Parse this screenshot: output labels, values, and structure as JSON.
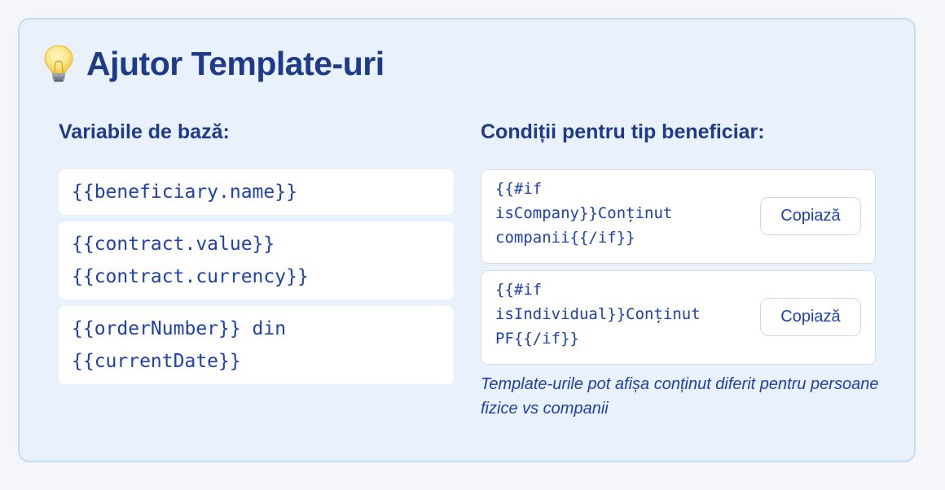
{
  "panel": {
    "title": "Ajutor Template-uri",
    "title_icon": "lightbulb-icon"
  },
  "basic_vars": {
    "heading": "Variabile de bază:",
    "items": [
      {
        "lines": [
          "{{beneficiary.name}}"
        ]
      },
      {
        "lines": [
          "{{contract.value}}",
          "{{contract.currency}}"
        ]
      },
      {
        "lines": [
          "{{orderNumber}} din",
          "{{currentDate}}"
        ]
      }
    ]
  },
  "conditions": {
    "heading": "Condiții pentru tip beneficiar:",
    "items": [
      {
        "lines": [
          "{{#if",
          "isCompany}}Conținut",
          "companii{{/if}}"
        ],
        "button_label": "Copiază"
      },
      {
        "lines": [
          "{{#if",
          "isIndividual}}Conținut",
          "PF{{/if}}"
        ],
        "button_label": "Copiază"
      }
    ],
    "note": "Template-urile pot afișa conținut diferit pentru persoane fizice vs companii"
  }
}
